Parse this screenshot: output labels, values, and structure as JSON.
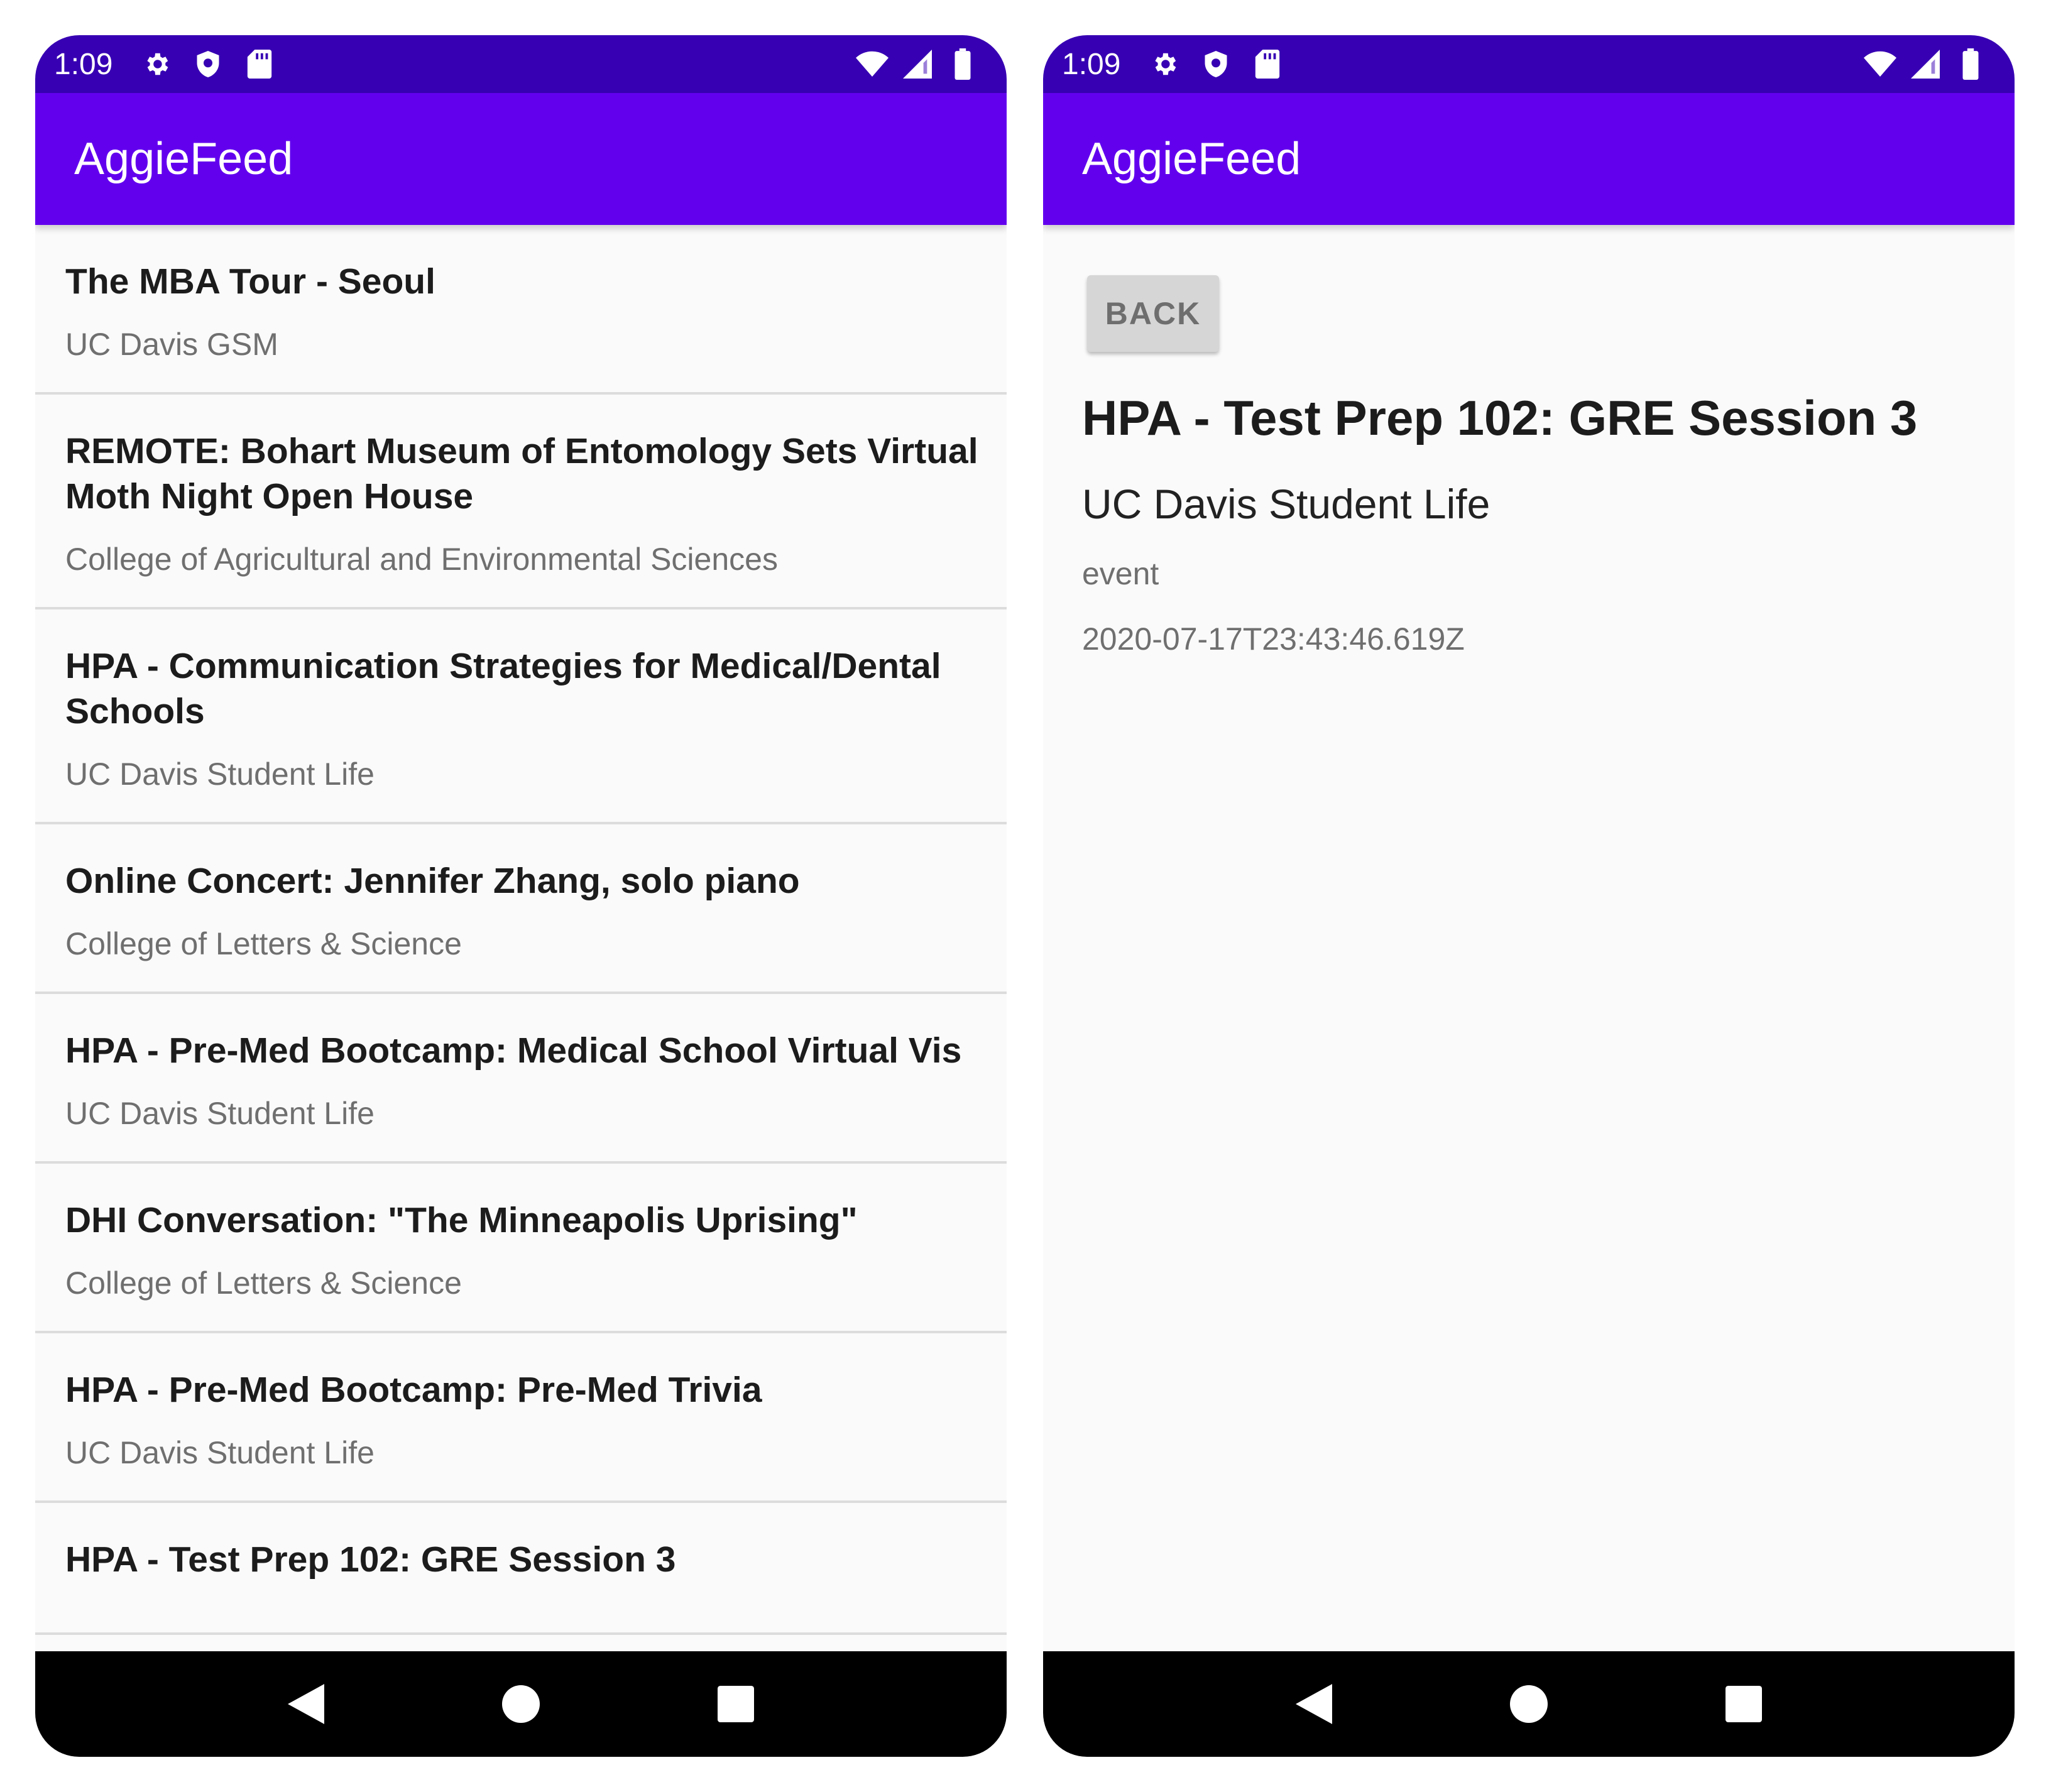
{
  "status_bar": {
    "time": "1:09",
    "left_icons": [
      "settings-icon",
      "shield-icon",
      "sd-card-icon"
    ],
    "right_icons": [
      "wifi-icon",
      "signal-icon",
      "battery-icon"
    ]
  },
  "app": {
    "title": "AggieFeed",
    "primary_color": "#6200ee",
    "status_color": "#3700b3"
  },
  "feed": {
    "items": [
      {
        "title": "The MBA Tour - Seoul",
        "org": "UC Davis GSM"
      },
      {
        "title": "REMOTE: Bohart Museum of Entomology Sets Virtual Moth Night Open House",
        "org": "College of Agricultural and Environmental Sciences"
      },
      {
        "title": "HPA - Communication Strategies for Medical/Dental Schools",
        "org": "UC Davis Student Life"
      },
      {
        "title": "Online Concert: Jennifer Zhang, solo piano",
        "org": "College of Letters & Science"
      },
      {
        "title": "HPA - Pre-Med Bootcamp: Medical School Virtual Vis",
        "org": "UC Davis Student Life"
      },
      {
        "title": "DHI Conversation: \"The Minneapolis Uprising\"",
        "org": "College of Letters & Science"
      },
      {
        "title": "HPA - Pre-Med Bootcamp: Pre-Med Trivia",
        "org": "UC Davis Student Life"
      },
      {
        "title": "HPA - Test Prep 102: GRE Session 3",
        "org": ""
      }
    ]
  },
  "detail": {
    "back_label": "BACK",
    "title": "HPA - Test Prep 102: GRE Session 3",
    "org": "UC Davis Student Life",
    "type": "event",
    "date": "2020-07-17T23:43:46.619Z"
  },
  "nav": {
    "back": "nav-back-icon",
    "home": "nav-home-icon",
    "recents": "nav-recents-icon"
  }
}
